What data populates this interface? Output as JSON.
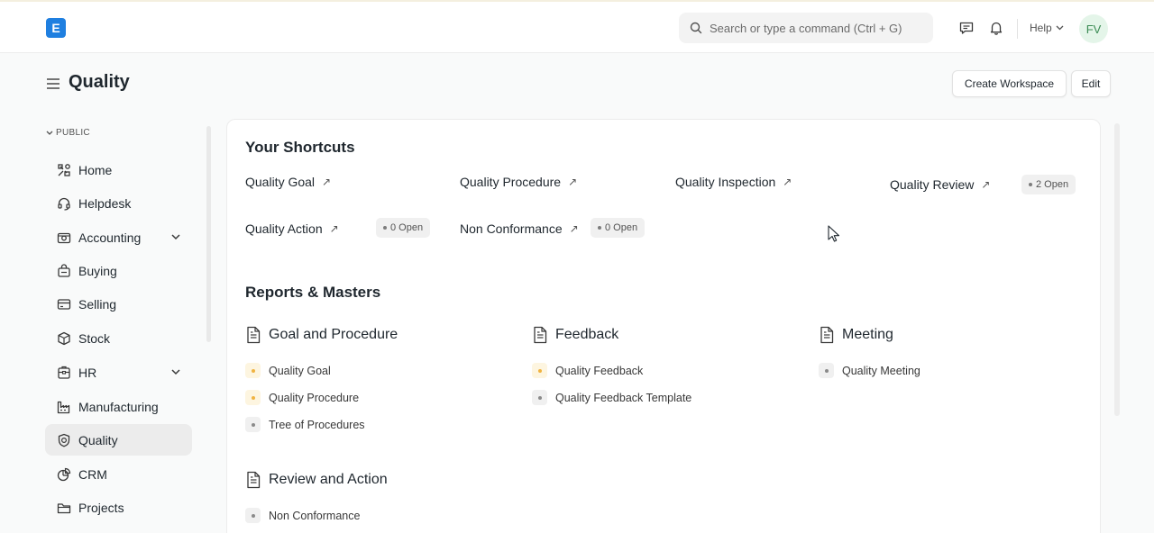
{
  "navbar": {
    "logo_letter": "E",
    "search_placeholder": "Search or type a command (Ctrl + G)",
    "help_label": "Help",
    "avatar_initials": "FV"
  },
  "page": {
    "title": "Quality",
    "create_workspace_label": "Create Workspace",
    "edit_label": "Edit"
  },
  "sidebar": {
    "section_label": "PUBLIC",
    "items": [
      {
        "label": "Home",
        "icon": "home-icon"
      },
      {
        "label": "Helpdesk",
        "icon": "headset-icon"
      },
      {
        "label": "Accounting",
        "icon": "accounting-icon"
      },
      {
        "label": "Buying",
        "icon": "basket-icon"
      },
      {
        "label": "Selling",
        "icon": "card-icon"
      },
      {
        "label": "Stock",
        "icon": "box-icon"
      },
      {
        "label": "HR",
        "icon": "id-card-icon"
      },
      {
        "label": "Manufacturing",
        "icon": "factory-icon"
      },
      {
        "label": "Quality",
        "icon": "shield-icon"
      },
      {
        "label": "CRM",
        "icon": "crm-icon"
      },
      {
        "label": "Projects",
        "icon": "folder-icon"
      }
    ]
  },
  "shortcuts": {
    "heading": "Your Shortcuts",
    "items": [
      {
        "label": "Quality Goal"
      },
      {
        "label": "Quality Procedure"
      },
      {
        "label": "Quality Inspection"
      },
      {
        "label": "Quality Review",
        "badge": "2 Open"
      },
      {
        "label": "Quality Action",
        "badge": "0 Open"
      },
      {
        "label": "Non Conformance",
        "badge": "0 Open"
      }
    ]
  },
  "reports": {
    "heading": "Reports & Masters",
    "groups": [
      {
        "title": "Goal and Procedure",
        "links": [
          "Quality Goal",
          "Quality Procedure",
          "Tree of Procedures"
        ]
      },
      {
        "title": "Feedback",
        "links": [
          "Quality Feedback",
          "Quality Feedback Template"
        ]
      },
      {
        "title": "Meeting",
        "links": [
          "Quality Meeting"
        ]
      },
      {
        "title": "Review and Action",
        "links": [
          "Non Conformance"
        ]
      }
    ]
  },
  "colors": {
    "accent": "#1f7fe0",
    "bullet_yellow": "#f0b341",
    "bullet_gray": "#8a8a8a"
  }
}
